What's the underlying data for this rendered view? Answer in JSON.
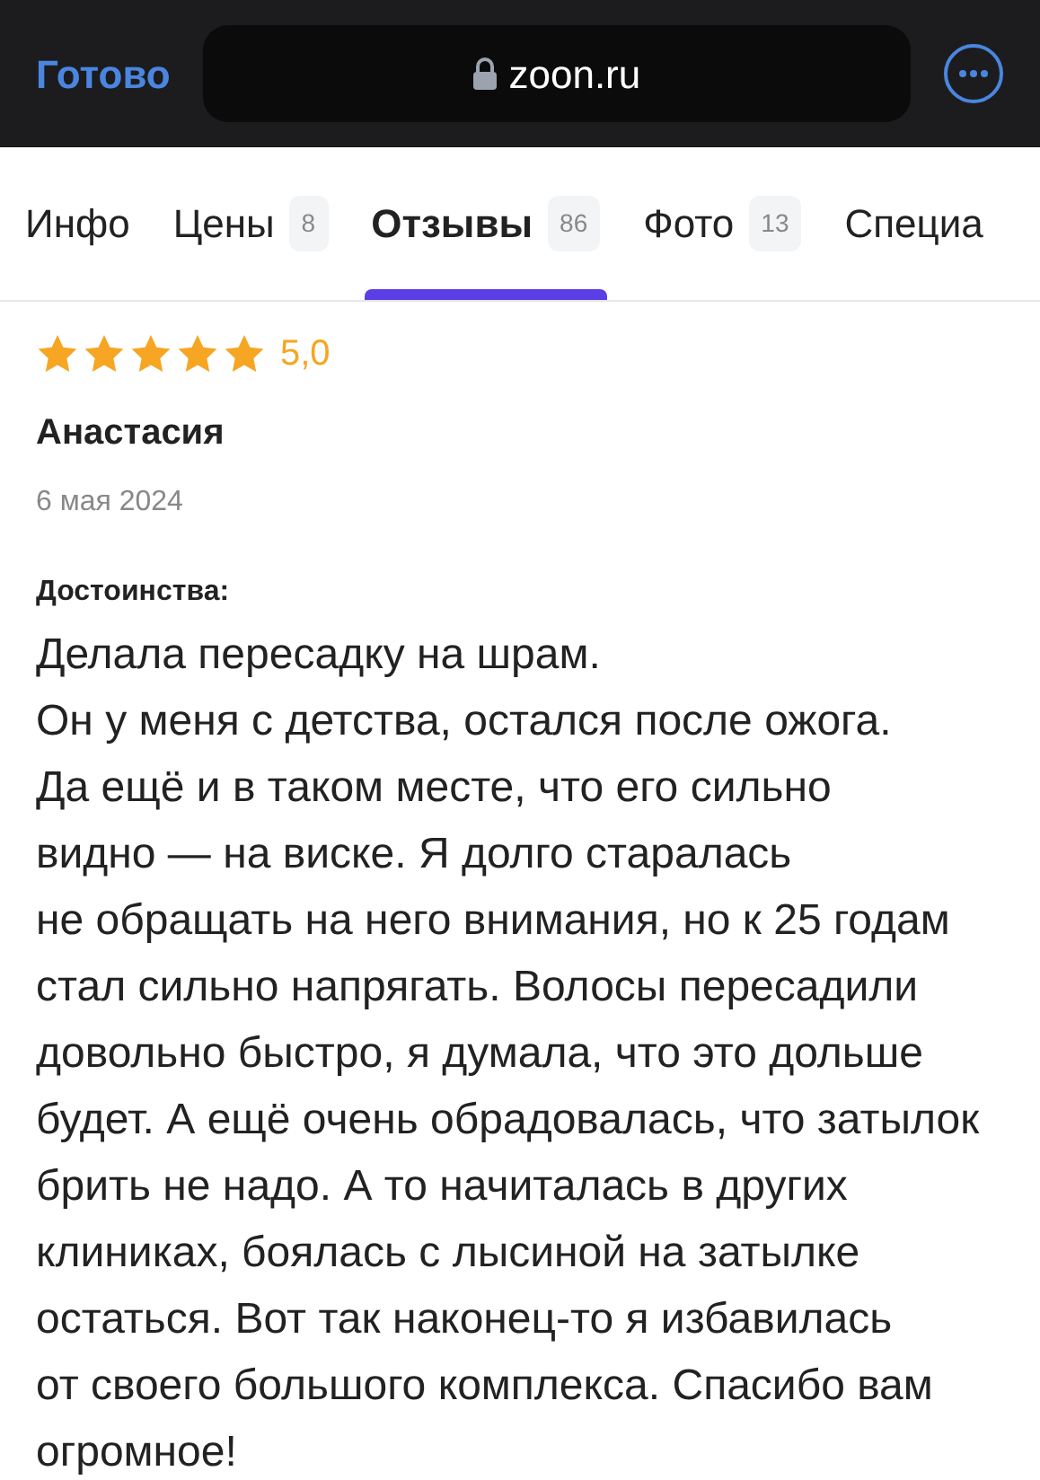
{
  "browser_bar": {
    "done_button": "Готово",
    "address": "zoon.ru"
  },
  "tabs": [
    {
      "label": "Инфо",
      "selected": false
    },
    {
      "label": "Цены",
      "count": "8",
      "selected": false
    },
    {
      "label": "Отзывы",
      "count": "86",
      "selected": true
    },
    {
      "label": "Фото",
      "count": "13",
      "selected": false
    },
    {
      "label": "Специа",
      "selected": false
    }
  ],
  "review": {
    "stars": 5,
    "rating": "5,0",
    "author": "Анастасия",
    "date": "6 мая 2024",
    "section_title": "Достоинства:",
    "text_lines": [
      "Делала пересадку на шрам.",
      "Он у меня с детства, остался после ожога.",
      "Да ещё и в таком месте, что его сильно",
      "видно — на виске. Я долго старалась",
      "не обращать на него внимания, но к 25 годам",
      "стал сильно напрягать. Волосы пересадили",
      "довольно быстро, я думала, что это дольше",
      "будет. А ещё очень обрадовалась, что затылок",
      "брить не надо. А то начиталась в других",
      "клиниках, боялась с лысиной на затылке",
      "остаться. Вот так наконец-то я избавилась",
      "от своего большого комплекса. Спасибо вам",
      "огромное!"
    ]
  }
}
